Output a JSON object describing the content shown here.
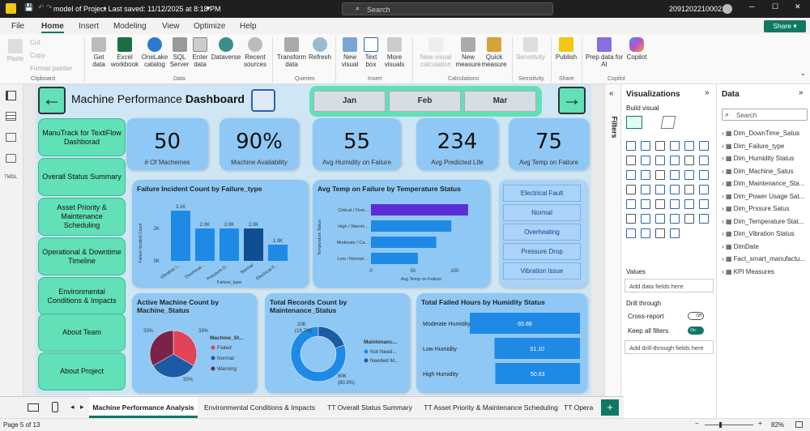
{
  "titlebar": {
    "file": "model of Project",
    "saved": "• Last saved: 11/12/2025 at 8:18 PM",
    "search_placeholder": "Search",
    "user": "20912022100021"
  },
  "menu": {
    "items": [
      "File",
      "Home",
      "Insert",
      "Modeling",
      "View",
      "Optimize",
      "Help"
    ],
    "share": "Share"
  },
  "ribbon": {
    "buttons": [
      {
        "label": "Paste"
      },
      {
        "label": "Get data"
      },
      {
        "label": "Excel workbook"
      },
      {
        "label": "OneLake catalog"
      },
      {
        "label": "SQL Server"
      },
      {
        "label": "Enter data"
      },
      {
        "label": "Dataverse"
      },
      {
        "label": "Recent sources"
      },
      {
        "label": "Transform data"
      },
      {
        "label": "Refresh"
      },
      {
        "label": "New visual"
      },
      {
        "label": "Text box"
      },
      {
        "label": "More visuals"
      },
      {
        "label": "New visual calculation"
      },
      {
        "label": "New measure"
      },
      {
        "label": "Quick measure"
      },
      {
        "label": "Sensitivity"
      },
      {
        "label": "Publish"
      },
      {
        "label": "Prep data for AI"
      },
      {
        "label": "Copilot"
      }
    ],
    "clip": [
      "Cut",
      "Copy",
      "Format painter"
    ],
    "groups": [
      "Clipboard",
      "Data",
      "Queries",
      "Insert",
      "Calculations",
      "Sensitivity",
      "Share",
      "Copilot"
    ]
  },
  "report": {
    "title_plain": "Machine Performance ",
    "title_bold": "Dashboard",
    "months": [
      "Jan",
      "Feb",
      "Mar"
    ],
    "nav": [
      "ManuTrack for TextiFlow Dashborad",
      "Overall Status Summary",
      "Asset Priority & Maintenance Scheduling",
      "Operational & Downtime Timeline",
      "Environmental Conditions & Impacts",
      "About Team",
      "About Project"
    ],
    "kpis": [
      {
        "value": "50",
        "label": "# Of Macheines"
      },
      {
        "value": "90%",
        "label": "Machine Availability"
      },
      {
        "value": "55",
        "label": "Avg Humidity on Failure"
      },
      {
        "value": "234",
        "label": "Avg Predicted Life"
      },
      {
        "value": "75",
        "label": "Avg Temp on Failure"
      }
    ],
    "failure_chart": {
      "title": "Failure Incident Count by Failure_type",
      "ylabel": "Failure Incident Count",
      "xlabel": "Failure_type",
      "ticks": [
        "2K",
        "0K"
      ]
    },
    "temp_chart": {
      "title": "Avg Temp on Failure by Temperature Status",
      "ylabel": "Temperature Status",
      "xlabel": "Avg Temp on Failure",
      "ticks": [
        "0",
        "50",
        "100"
      ]
    },
    "slicer": [
      "Electrical Fault",
      "Normal",
      "Overheating",
      "Pressure Drop",
      "Vibration Issue"
    ],
    "pie_chart": {
      "title": "Active Machine Count by Machine_Status",
      "legend_title": "Machine_St...",
      "legend": [
        "Failed",
        "Normal",
        "Warning"
      ],
      "labels": [
        "33%",
        "33%",
        "33%"
      ]
    },
    "donut_chart": {
      "title": "Total Records Count by Maintenance_Status",
      "legend_title": "Maintenanc...",
      "legend": [
        "Not Need...",
        "Needed M..."
      ],
      "label_a": "20K",
      "label_a2": "(19.7%)",
      "label_b": "80K",
      "label_b2": "(80.3%)"
    },
    "humidity_chart": {
      "title": "Total Failed Hours by Humidity Status"
    }
  },
  "chart_data": [
    {
      "type": "bar",
      "title": "Failure Incident Count by Failure_type",
      "categories": [
        "Vibration I...",
        "Overheati...",
        "Pressure D...",
        "Normal",
        "Electrical F..."
      ],
      "values": [
        3100,
        2000,
        2000,
        2000,
        1000
      ],
      "labels": [
        "3.1K",
        "2.0K",
        "2.0K",
        "2.0K",
        "1.0K"
      ],
      "ylim": [
        0,
        3500
      ]
    },
    {
      "type": "bar",
      "title": "Avg Temp on Failure by Temperature Status",
      "categories": [
        "Critical / Over...",
        "High / Warnin...",
        "Moderate / Ca...",
        "Low / Normal ..."
      ],
      "values": [
        116,
        96,
        78,
        56
      ],
      "xlim": [
        0,
        120
      ]
    },
    {
      "type": "pie",
      "title": "Active Machine Count by Machine_Status",
      "categories": [
        "Failed",
        "Normal",
        "Warning"
      ],
      "values": [
        33,
        33,
        33
      ]
    },
    {
      "type": "pie",
      "title": "Total Records Count by Maintenance_Status",
      "categories": [
        "Not Need...",
        "Needed M..."
      ],
      "values": [
        80.3,
        19.7
      ]
    },
    {
      "type": "bar",
      "title": "Total Failed Hours by Humidity Status",
      "categories": [
        "Moderate Humidity",
        "Low Humidity",
        "High Humidity"
      ],
      "values": [
        65.88,
        51.1,
        50.63
      ],
      "labels": [
        "65.88",
        "51.10",
        "50.63"
      ]
    }
  ],
  "viz": {
    "title": "Visualizations",
    "build": "Build visual",
    "values": "Values",
    "values_ph": "Add data fields here",
    "drill": "Drill through",
    "cross": "Cross-report",
    "cross_state": "Off",
    "keep": "Keep all filters",
    "keep_state": "On",
    "drill_ph": "Add drill-through fields here",
    "filters": "Filters"
  },
  "data": {
    "title": "Data",
    "search": "Search",
    "tables": [
      "Dim_DownTime_Satus",
      "Dim_Failure_type",
      "Dim_Humidity Status",
      "Dim_Machine_Satus",
      "Dim_Maintenance_Sta...",
      "Dim_Power Usage Sat...",
      "Dim_Prssure Satus",
      "Dim_Temperature Stat...",
      "Dim_Vibration Status",
      "DimDate",
      "Fact_smart_manufactu...",
      "KPI Measures"
    ]
  },
  "tabs": [
    "Machine Performance Analysis",
    "Environmental Conditions & Impacts",
    "TT Overall Status Summary",
    "TT Asset Priority & Maintenance Scheduling",
    "TT Opera"
  ],
  "status": {
    "page": "Page 5 of 13",
    "zoom": "82%"
  },
  "colors": {
    "mint": "#62e0b8",
    "card": "#8fc8f5",
    "bar": "#1e8ae6",
    "dark_bar": "#0f4f91",
    "purple": "#5a2dd6",
    "pie_red": "#e0435a",
    "pie_blue": "#1d5aa5",
    "pie_maroon": "#7b2346"
  }
}
